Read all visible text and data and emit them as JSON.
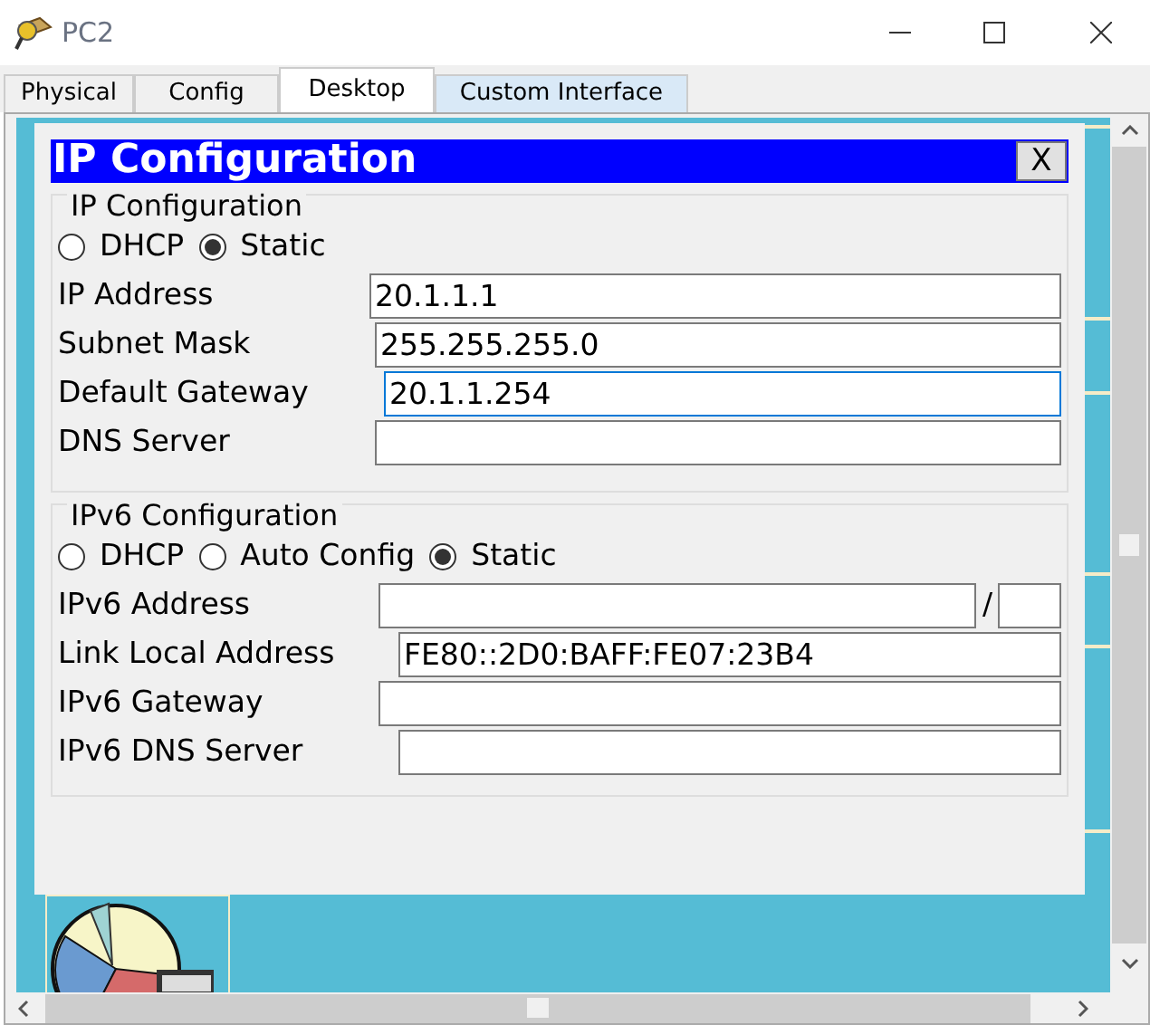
{
  "window": {
    "title": "PC2"
  },
  "tabs": [
    {
      "label": "Physical",
      "selected": false
    },
    {
      "label": "Config",
      "selected": false
    },
    {
      "label": "Desktop",
      "selected": true
    },
    {
      "label": "Custom Interface",
      "selected": false
    }
  ],
  "dialog": {
    "title": "IP Configuration",
    "close": "X",
    "ipv4": {
      "legend": "IP Configuration",
      "modes": [
        {
          "label": "DHCP",
          "selected": false
        },
        {
          "label": "Static",
          "selected": true
        }
      ],
      "fields": [
        {
          "label": "IP Address",
          "value": "20.1.1.1",
          "focused": false
        },
        {
          "label": "Subnet Mask",
          "value": "255.255.255.0",
          "focused": false
        },
        {
          "label": "Default Gateway",
          "value": "20.1.1.254",
          "focused": true
        },
        {
          "label": "DNS Server",
          "focused": false
        }
      ]
    },
    "ipv6": {
      "legend": "IPv6 Configuration",
      "modes": [
        {
          "label": "DHCP",
          "selected": false
        },
        {
          "label": "Auto Config",
          "selected": false
        },
        {
          "label": "Static",
          "selected": true
        }
      ],
      "fields": [
        {
          "label": "IPv6 Address",
          "prefix": "/",
          "focused": false
        },
        {
          "label": "Link Local Address",
          "value": "FE80::2D0:BAFF:FE07:23B4",
          "focused": false
        },
        {
          "label": "IPv6 Gateway",
          "focused": false
        },
        {
          "label": "IPv6 DNS Server",
          "focused": false
        }
      ]
    }
  }
}
